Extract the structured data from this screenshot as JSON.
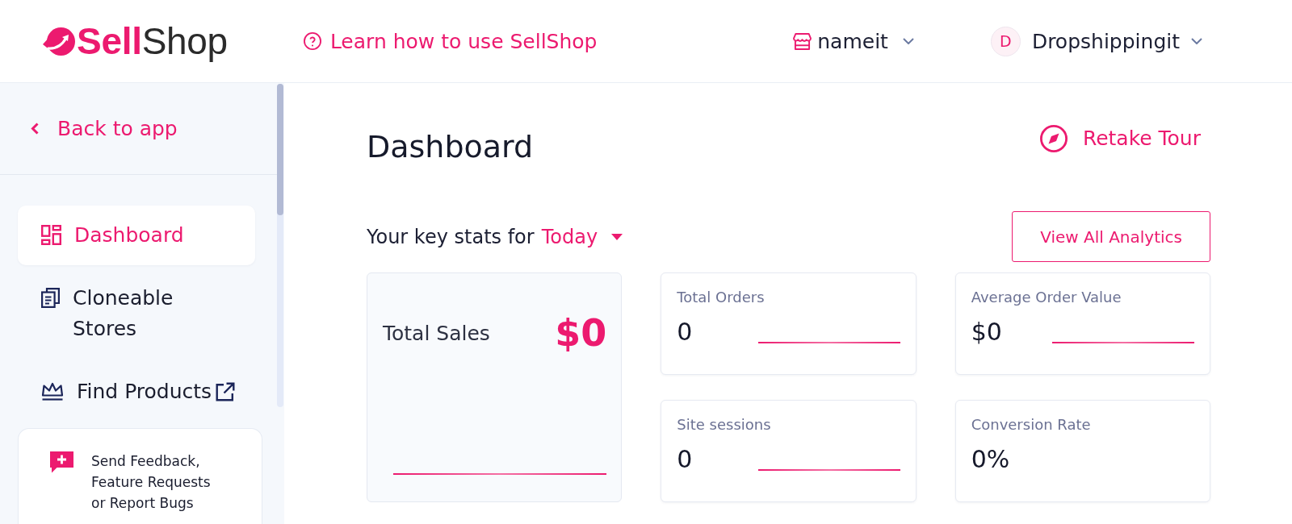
{
  "header": {
    "logo": "**Sell**Shop",
    "help_link": "Learn how to use SellShop",
    "store": {
      "name": "nameit"
    },
    "account": {
      "initial": "D",
      "name": "Dropshippingit"
    }
  },
  "sidebar": {
    "back_link": "Back to app",
    "items": [
      {
        "label": "Dashboard",
        "selected": true,
        "external": false
      },
      {
        "label": "Cloneable Stores",
        "selected": false,
        "external": false
      },
      {
        "label": "Find Products",
        "selected": false,
        "external": true
      }
    ],
    "feedback": "Send Feedback, Feature Requests or Report Bugs"
  },
  "main": {
    "title": "Dashboard",
    "tour_button": "Retake Tour",
    "stats_prefix": "Your key stats for",
    "period": "Today",
    "analytics_button": "View All Analytics",
    "stats": [
      {
        "kind": "featured",
        "label": "Total Sales",
        "value": "$0",
        "sparkline": true
      },
      {
        "kind": "compact",
        "label": "Total Orders",
        "value": "0",
        "sparkline": true
      },
      {
        "kind": "compact",
        "label": "Average Order Value",
        "value": "$0",
        "sparkline": true
      },
      {
        "kind": "compact",
        "label": "Site sessions",
        "value": "0",
        "sparkline": true
      },
      {
        "kind": "compact",
        "label": "Conversion Rate",
        "value": "0%",
        "sparkline": false
      }
    ]
  }
}
